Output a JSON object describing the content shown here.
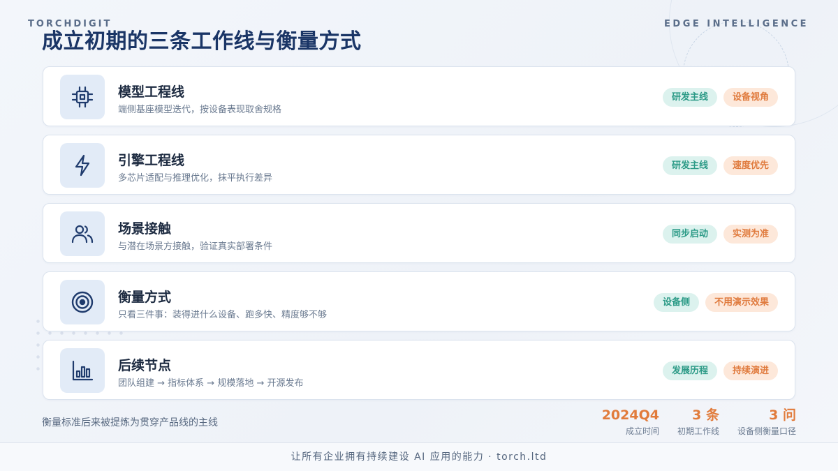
{
  "brand_left": "TORCHDIGIT",
  "brand_right": "EDGE INTELLIGENCE",
  "title": "成立初期的三条工作线与衡量方式",
  "cards": [
    {
      "icon": "chip-icon",
      "title": "模型工程线",
      "subtitle": "端侧基座模型迭代，按设备表现取舍规格",
      "tags": [
        "研发主线",
        "设备视角"
      ]
    },
    {
      "icon": "lightning-icon",
      "title": "引擎工程线",
      "subtitle": "多芯片适配与推理优化，抹平执行差异",
      "tags": [
        "研发主线",
        "速度优先"
      ]
    },
    {
      "icon": "users-icon",
      "title": "场景接触",
      "subtitle": "与潜在场景方接触，验证真实部署条件",
      "tags": [
        "同步启动",
        "实测为准"
      ]
    },
    {
      "icon": "target-icon",
      "title": "衡量方式",
      "subtitle": "只看三件事：装得进什么设备、跑多快、精度够不够",
      "tags": [
        "设备侧",
        "不用演示效果"
      ]
    },
    {
      "icon": "bar-chart-icon",
      "title": "后续节点",
      "subtitle": "团队组建 → 指标体系 → 规模落地 → 开源发布",
      "tags": [
        "发展历程",
        "持续演进"
      ]
    }
  ],
  "footer_note": "衡量标准后来被提炼为贯穿产品线的主线",
  "stats": [
    {
      "value": "2024Q4",
      "label": "成立时间"
    },
    {
      "value": "3 条",
      "label": "初期工作线"
    },
    {
      "value": "3 问",
      "label": "设备侧衡量口径"
    }
  ],
  "bottom_text": "让所有企业拥有持续建设 AI 应用的能力 · torch.ltd",
  "colors": {
    "title": "#1a3566",
    "accent_orange": "#e17b3b",
    "tag_green": "#2b9a86",
    "icon_stroke": "#1f3b6d"
  }
}
